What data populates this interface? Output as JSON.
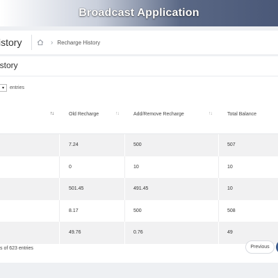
{
  "banner": {
    "title": "Broadcast Application"
  },
  "header": {
    "page_title": "istory",
    "breadcrumb": {
      "home_icon": "home-icon",
      "separator_icon": "chevron-right-icon",
      "current": "Recharge History"
    }
  },
  "card": {
    "title": "istory",
    "entries_label": "entries",
    "entries_select_icon": "caret-down-icon"
  },
  "table": {
    "columns": [
      {
        "label": "",
        "sort": "sort-active-icon"
      },
      {
        "label": "Old Recharge",
        "sort": "sort-icon"
      },
      {
        "label": "Add/Remove Recharge",
        "sort": "sort-icon"
      },
      {
        "label": "Total Balance",
        "sort": ""
      }
    ],
    "rows": [
      {
        "old": "7.24",
        "add": "500",
        "total": "507"
      },
      {
        "old": "0",
        "add": "10",
        "total": "10"
      },
      {
        "old": "501.45",
        "add": "491.45",
        "total": "10"
      },
      {
        "old": "8.17",
        "add": "500",
        "total": "508"
      },
      {
        "old": "49.76",
        "add": "0.76",
        "total": "49"
      }
    ]
  },
  "footer": {
    "info": "s of 623 entries",
    "previous_label": "Previous"
  },
  "colors": {
    "banner_dark": "#4a5878",
    "row_stripe": "#f1f1f2",
    "next_button": "#3a5a8c"
  }
}
